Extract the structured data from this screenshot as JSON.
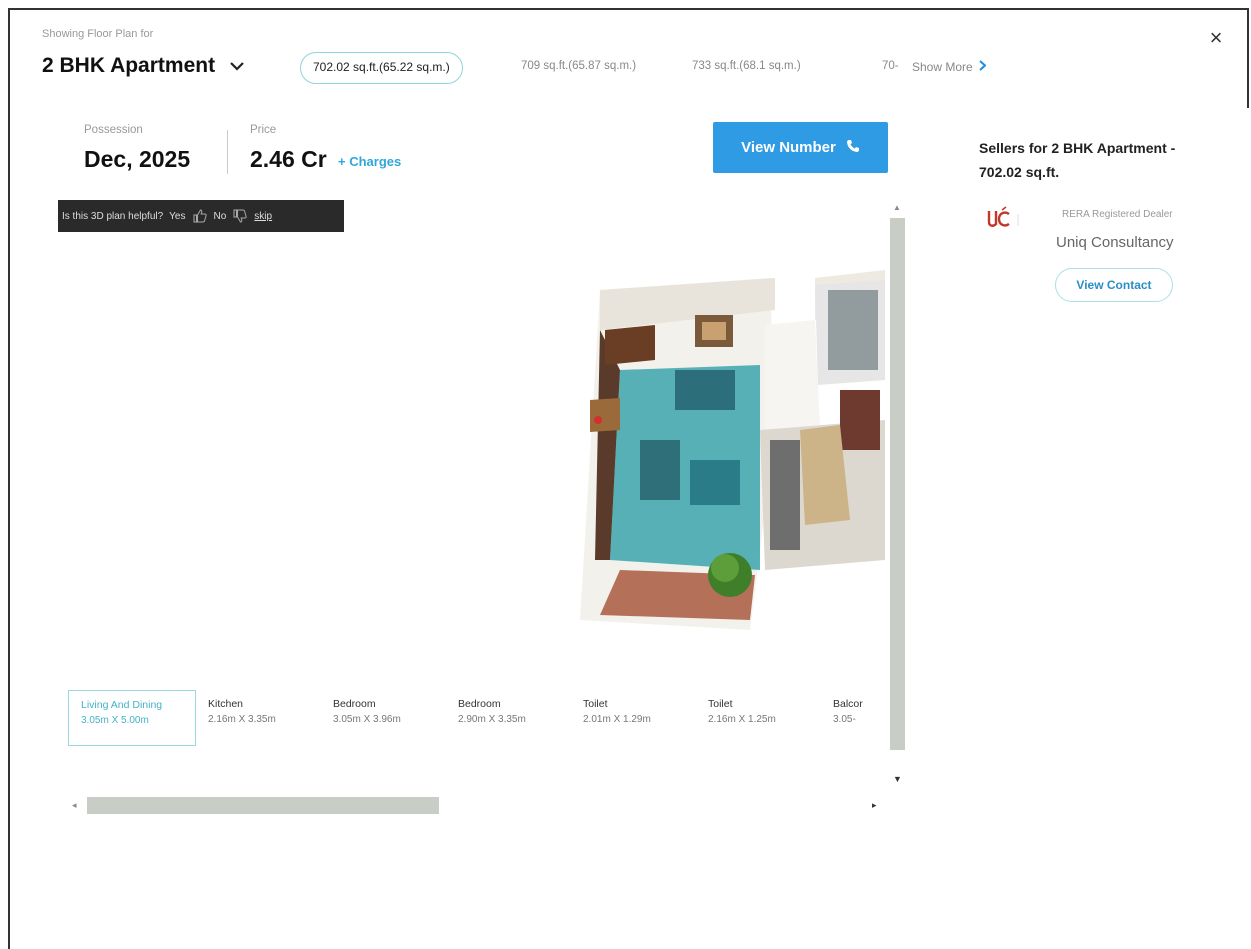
{
  "header": {
    "showing_label": "Showing Floor Plan for",
    "apartment_type": "2 BHK Apartment",
    "close_symbol": "×"
  },
  "sizes": {
    "selected": "702.02 sq.ft.(65.22 sq.m.)",
    "options": [
      "709 sq.ft.(65.87 sq.m.)",
      "733 sq.ft.(68.1 sq.m.)",
      "70-"
    ],
    "show_more": "Show More"
  },
  "summary": {
    "possession_label": "Possession",
    "possession_value": "Dec, 2025",
    "price_label": "Price",
    "price_value": "2.46 Cr",
    "charges_link": "+ Charges"
  },
  "actions": {
    "view_number": "View Number"
  },
  "feedback": {
    "question": "Is this 3D plan helpful?",
    "yes": "Yes",
    "no": "No",
    "skip": "skip"
  },
  "rooms": [
    {
      "name": "Living And Dining",
      "size": "3.05m X 5.00m"
    },
    {
      "name": "Kitchen",
      "size": "2.16m X 3.35m"
    },
    {
      "name": "Bedroom",
      "size": "3.05m X 3.96m"
    },
    {
      "name": "Bedroom",
      "size": "2.90m X 3.35m"
    },
    {
      "name": "Toilet",
      "size": "2.01m X 1.29m"
    },
    {
      "name": "Toilet",
      "size": "2.16m X 1.25m"
    },
    {
      "name": "Balcor",
      "size": "3.05-"
    }
  ],
  "sellers": {
    "title": "Sellers for 2 BHK Apartment - 702.02 sq.ft.",
    "badge": "RERA Registered Dealer",
    "dealer_name": "Uniq Consultancy",
    "view_contact": "View Contact"
  },
  "colors": {
    "accent_blue": "#2f9be4",
    "chip_border": "#8fd4dc",
    "link_teal": "#2fa8d8"
  }
}
